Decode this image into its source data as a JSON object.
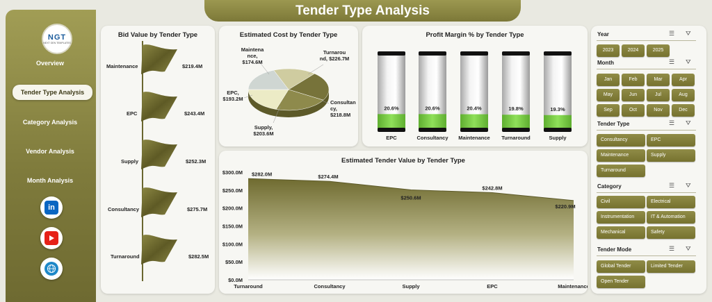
{
  "app": {
    "title": "Tender Type Analysis",
    "logo_text": "NGT",
    "logo_subtext": "NEXT GEN TEMPLATES"
  },
  "sidebar": {
    "items": [
      {
        "label": "Overview",
        "active": false
      },
      {
        "label": "Tender Type Analysis",
        "active": true
      },
      {
        "label": "Category Analysis",
        "active": false
      },
      {
        "label": "Vendor Analysis",
        "active": false
      },
      {
        "label": "Month Analysis",
        "active": false
      }
    ],
    "social": [
      {
        "icon": "linkedin-icon",
        "glyph": "in",
        "color": "#0a66c2"
      },
      {
        "icon": "youtube-icon",
        "glyph": "▶",
        "color": "#e62117"
      },
      {
        "icon": "globe-icon",
        "glyph": "🌐",
        "color": "#1e88c8"
      }
    ]
  },
  "colors": {
    "olive": "#8a8640",
    "olive_dark": "#6e6a31",
    "green": "#7fd14a",
    "area_top": "#6f6b30",
    "area_bottom": "#ffffff"
  },
  "charts": {
    "bid_value": {
      "title": "Bid Value by Tender Type",
      "categories": [
        "Maintenance",
        "EPC",
        "Supply",
        "Consultancy",
        "Turnaround"
      ],
      "value_labels": [
        "$219.4M",
        "$243.4M",
        "$252.3M",
        "$275.7M",
        "$282.5M"
      ]
    },
    "est_cost": {
      "title": "Estimated Cost by Tender Type",
      "labels": [
        {
          "name": "Maintena nce,",
          "value": "$174.6M"
        },
        {
          "name": "Turnarou nd,",
          "value": "$226.7M"
        },
        {
          "name": "EPC,",
          "value": "$193.2M"
        },
        {
          "name": "Consultan cy,",
          "value": "$218.8M"
        },
        {
          "name": "Supply,",
          "value": "$203.6M"
        }
      ]
    },
    "profit_margin": {
      "title": "Profit Margin % by Tender Type",
      "labels": [
        "20.6%",
        "20.6%",
        "20.4%",
        "19.8%",
        "19.3%"
      ]
    },
    "est_tender_value": {
      "title": "Estimated Tender Value by Tender Type",
      "y_ticks": [
        "$300.0M",
        "$250.0M",
        "$200.0M",
        "$150.0M",
        "$100.0M",
        "$50.0M",
        "$0.0M"
      ],
      "data_labels": [
        "$282.0M",
        "$274.4M",
        "$250.6M",
        "$242.8M",
        "$220.9M"
      ]
    }
  },
  "chart_data": [
    {
      "type": "bar",
      "title": "Bid Value by Tender Type",
      "categories": [
        "Maintenance",
        "EPC",
        "Supply",
        "Consultancy",
        "Turnaround"
      ],
      "values": [
        219.4,
        243.4,
        252.3,
        275.7,
        282.5
      ]
    },
    {
      "type": "pie",
      "title": "Estimated Cost by Tender Type",
      "categories": [
        "Maintenance",
        "Turnaround",
        "Consultancy",
        "Supply",
        "EPC"
      ],
      "values": [
        174.6,
        226.7,
        218.8,
        203.6,
        193.2
      ],
      "colors": [
        "#cfcca0",
        "#77733a",
        "#8e8a4c",
        "#ecebc6",
        "#cfd6d2"
      ]
    },
    {
      "type": "bar",
      "title": "Profit Margin % by Tender Type",
      "categories": [
        "EPC",
        "Consultancy",
        "Maintenance",
        "Turnaround",
        "Supply"
      ],
      "values": [
        20.6,
        20.6,
        20.4,
        19.8,
        19.3
      ]
    },
    {
      "type": "area",
      "title": "Estimated Tender Value by Tender Type",
      "categories": [
        "Turnaround",
        "Consultancy",
        "Supply",
        "EPC",
        "Maintenance"
      ],
      "values": [
        282.0,
        274.4,
        250.6,
        242.8,
        220.9
      ],
      "ylim": [
        0,
        300
      ]
    }
  ],
  "filters": {
    "year": {
      "title": "Year",
      "options": [
        "2023",
        "2024",
        "2025"
      ]
    },
    "month": {
      "title": "Month",
      "options": [
        "Jan",
        "Feb",
        "Mar",
        "Apr",
        "May",
        "Jun",
        "Jul",
        "Aug",
        "Sep",
        "Oct",
        "Nov",
        "Dec"
      ]
    },
    "tender_type": {
      "title": "Tender Type",
      "options": [
        "Consultancy",
        "EPC",
        "Maintenance",
        "Supply",
        "Turnaround"
      ]
    },
    "category": {
      "title": "Category",
      "options": [
        "Civil",
        "Electrical",
        "Instrumentation",
        "IT & Automation",
        "Mechanical",
        "Safety"
      ]
    },
    "tender_mode": {
      "title": "Tender Mode",
      "options": [
        "Global Tender",
        "Limited Tender",
        "Open Tender"
      ]
    }
  }
}
